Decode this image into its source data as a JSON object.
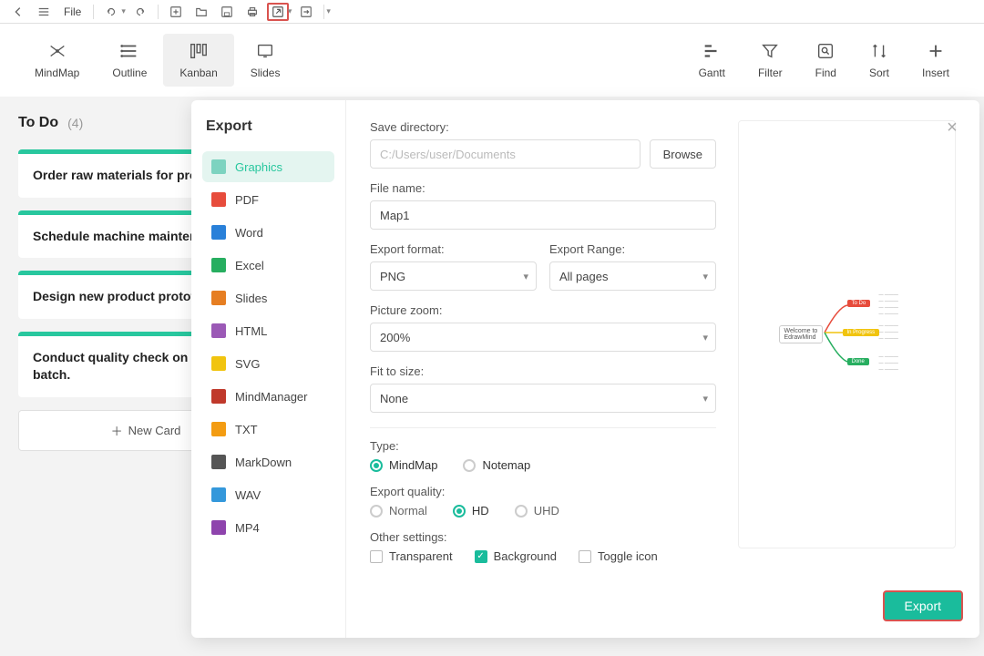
{
  "toolbar": {
    "file_label": "File"
  },
  "sec_toolbar": {
    "mindmap": "MindMap",
    "outline": "Outline",
    "kanban": "Kanban",
    "slides": "Slides",
    "gantt": "Gantt",
    "filter": "Filter",
    "find": "Find",
    "sort": "Sort",
    "insert": "Insert"
  },
  "kanban": {
    "col_title": "To Do",
    "col_count": "(4)",
    "cards": [
      "Order raw materials for production.",
      "Schedule machine maintenance.",
      "Design new product prototype.",
      "Conduct quality check on previous batch."
    ],
    "new_card": "New Card"
  },
  "dialog": {
    "title": "Export",
    "formats": {
      "graphics": "Graphics",
      "pdf": "PDF",
      "word": "Word",
      "excel": "Excel",
      "slides": "Slides",
      "html": "HTML",
      "svg": "SVG",
      "mindmanager": "MindManager",
      "txt": "TXT",
      "markdown": "MarkDown",
      "wav": "WAV",
      "mp4": "MP4"
    },
    "labels": {
      "save_dir": "Save directory:",
      "file_name": "File name:",
      "export_format": "Export format:",
      "export_range": "Export Range:",
      "picture_zoom": "Picture zoom:",
      "fit_to_size": "Fit to size:",
      "type": "Type:",
      "export_quality": "Export quality:",
      "other_settings": "Other settings:"
    },
    "values": {
      "save_dir_placeholder": "C:/Users/user/Documents",
      "file_name": "Map1",
      "export_format": "PNG",
      "export_range": "All pages",
      "picture_zoom": "200%",
      "fit_to_size": "None"
    },
    "type_opts": {
      "mindmap": "MindMap",
      "notemap": "Notemap"
    },
    "quality_opts": {
      "normal": "Normal",
      "hd": "HD",
      "uhd": "UHD"
    },
    "other_opts": {
      "transparent": "Transparent",
      "background": "Background",
      "toggle_icon": "Toggle icon"
    },
    "browse": "Browse",
    "export": "Export",
    "preview_center": "Welcome to\nEdrawMind",
    "preview_nodes": {
      "todo": "To Do",
      "prog": "In Progress",
      "done": "Done"
    }
  }
}
